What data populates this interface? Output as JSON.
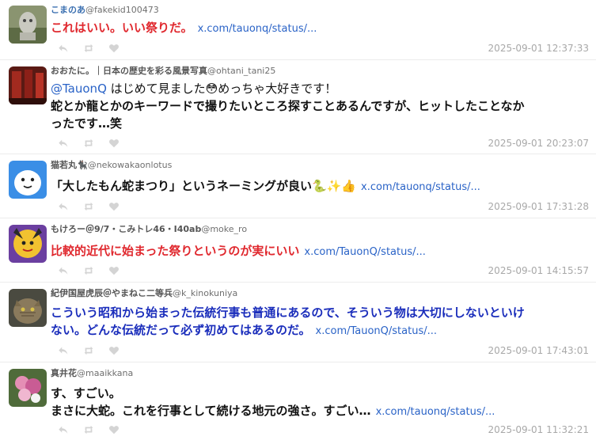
{
  "posts": [
    {
      "display_name": "こまのあ",
      "handle": "@fakekid100473",
      "text": "これはいい。いい祭りだ。",
      "link": "x.com/tauonq/status/...",
      "timestamp": "2025-09-01 12:37:33"
    },
    {
      "display_name": "おおたに。｜日本の歴史を彩る風景写真",
      "handle": "@ohtani_tani25",
      "mention": "@TauonQ",
      "line1": " はじめて見ました😳めっちゃ大好きです！",
      "line2": "蛇とか龍とかのキーワードで撮りたいところ探すことあるんですが、ヒットしたことなか",
      "line3": "ったです…笑",
      "timestamp": "2025-09-01 20:23:07"
    },
    {
      "display_name": "猫若丸🐈‍⬛",
      "handle": "@nekowakaonlotus",
      "text": "「大したもん蛇まつり」というネーミングが良い🐍✨👍",
      "link": "x.com/tauonq/status/...",
      "timestamp": "2025-09-01 17:31:28"
    },
    {
      "display_name": "もけろー＠9/7・こみトレ46・I40ab",
      "handle": "@moke_ro",
      "text": "比較的近代に始まった祭りというのが実にいい",
      "link": "x.com/TauonQ/status/...",
      "timestamp": "2025-09-01 14:15:57"
    },
    {
      "display_name": "紀伊国屋虎辰＠やまねこ二等兵",
      "handle": "@k_kinokuniya",
      "line1": "こういう昭和から始まった伝統行事も普通にあるので、そういう物は大切にしないといけ",
      "line2": "ない。どんな伝統だって必ず初めてはあるのだ。",
      "link": "x.com/TauonQ/status/...",
      "timestamp": "2025-09-01 17:43:01"
    },
    {
      "display_name": "真井花",
      "handle": "@maaikkana",
      "line1": "す、すごい。",
      "line2": "まさに大蛇。これを行事として続ける地元の強さ。すごい…",
      "link": "x.com/tauonq/status/...",
      "timestamp": "2025-09-01 11:32:21"
    }
  ],
  "icons": {
    "reply": "reply-icon",
    "retweet": "retweet-icon",
    "like": "heart-icon"
  },
  "colors": {
    "red_text": "#e0282e",
    "navy_text": "#1a2dbb",
    "link": "#2a63c7",
    "timestamp": "#a8a8a8",
    "action_icon": "#d4d4d4"
  }
}
